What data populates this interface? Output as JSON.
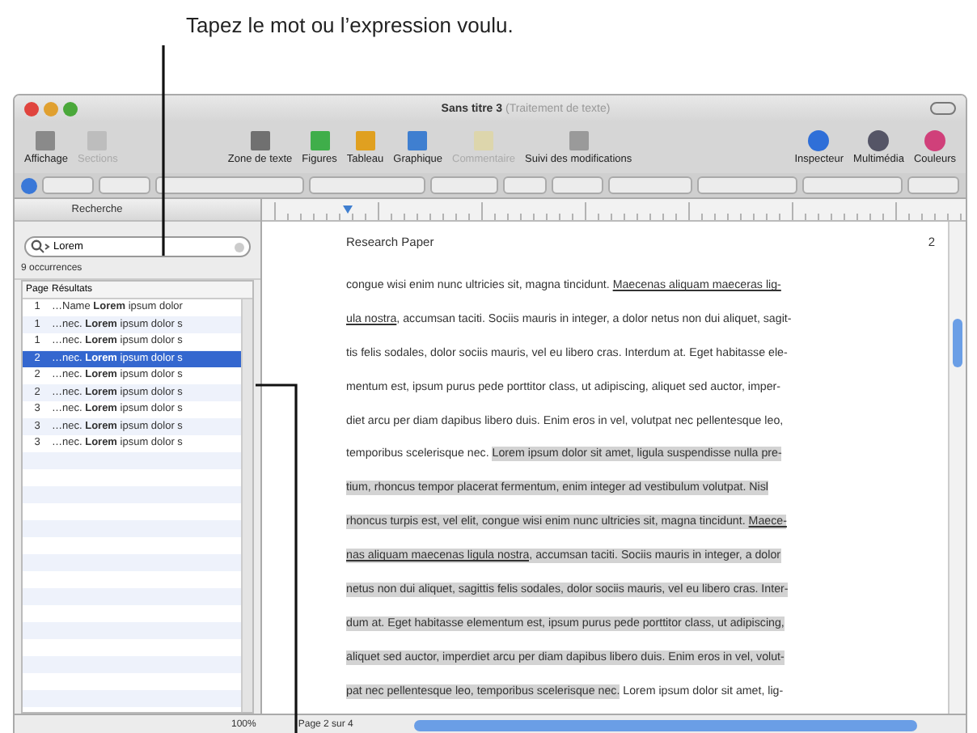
{
  "callout": {
    "text": "Tapez le mot ou l’expression voulu."
  },
  "window": {
    "title": "Sans titre 3",
    "subtitle": "(Traitement de texte)"
  },
  "toolbar": {
    "items": [
      {
        "label": "Affichage",
        "disabled": false
      },
      {
        "label": "Sections",
        "disabled": true
      },
      {
        "label": "Zone de texte",
        "disabled": false
      },
      {
        "label": "Figures",
        "disabled": false
      },
      {
        "label": "Tableau",
        "disabled": false
      },
      {
        "label": "Graphique",
        "disabled": false
      },
      {
        "label": "Commentaire",
        "disabled": true
      },
      {
        "label": "Suivi des modifications",
        "disabled": false
      },
      {
        "label": "Inspecteur",
        "disabled": false
      },
      {
        "label": "Multimédia",
        "disabled": false
      },
      {
        "label": "Couleurs",
        "disabled": false
      }
    ]
  },
  "sidebar": {
    "title": "Recherche",
    "search": {
      "value": "Lorem"
    },
    "count": "9 occurrences",
    "columns": [
      "Page",
      "Résultats"
    ],
    "rows": [
      {
        "page": "1",
        "result": "…Name **Lorem** ipsum dolor",
        "selected": false
      },
      {
        "page": "1",
        "result": "…nec. **Lorem** ipsum dolor s",
        "selected": false
      },
      {
        "page": "1",
        "result": "…nec. **Lorem** ipsum dolor s",
        "selected": false
      },
      {
        "page": "2",
        "result": "…nec. **Lorem** ipsum dolor s",
        "selected": true
      },
      {
        "page": "2",
        "result": "…nec. **Lorem** ipsum dolor s",
        "selected": false
      },
      {
        "page": "2",
        "result": "…nec. **Lorem** ipsum dolor s",
        "selected": false
      },
      {
        "page": "3",
        "result": "…nec. **Lorem** ipsum dolor s",
        "selected": false
      },
      {
        "page": "3",
        "result": "…nec. **Lorem** ipsum dolor s",
        "selected": false
      },
      {
        "page": "3",
        "result": "…nec. **Lorem** ipsum dolor s",
        "selected": false
      }
    ]
  },
  "document": {
    "header": "Research Paper",
    "page_number": "2",
    "lines": [
      [
        {
          "kind": "plain",
          "text": "congue wisi enim nunc ultricies sit, magna tincidunt. "
        },
        {
          "kind": "link",
          "text": "Maecenas aliquam maeceras lig-"
        }
      ],
      [
        {
          "kind": "link",
          "text": "ula nostra"
        },
        {
          "kind": "plain",
          "text": ", accumsan taciti. Sociis mauris in integer, a dolor netus non dui aliquet, sagit-"
        }
      ],
      [
        {
          "kind": "plain",
          "text": "tis felis sodales, dolor sociis mauris, vel eu libero cras. Interdum at. Eget habitasse ele-"
        }
      ],
      [
        {
          "kind": "plain",
          "text": "mentum est, ipsum purus pede porttitor class, ut adipiscing, aliquet sed auctor, imper-"
        }
      ],
      [
        {
          "kind": "plain",
          "text": "diet arcu per diam dapibus libero duis. Enim eros in vel, volutpat nec pellentesque leo,"
        }
      ],
      [
        {
          "kind": "plain",
          "text": "temporibus scelerisque nec. "
        },
        {
          "kind": "selected",
          "text": "Lorem ipsum dolor sit amet, ligula suspendisse nulla pre-"
        }
      ],
      [
        {
          "kind": "selected",
          "text": "tium, rhoncus tempor placerat fermentum, enim integer ad vestibulum volutpat. Nisl"
        }
      ],
      [
        {
          "kind": "selected",
          "text": "rhoncus turpis est, vel elit, congue wisi enim nunc ultricies sit, magna tincidunt. "
        },
        {
          "kind": "selected-link",
          "text": "Maece-"
        }
      ],
      [
        {
          "kind": "selected-link",
          "text": "nas aliquam maecenas ligula nostra"
        },
        {
          "kind": "selected",
          "text": ", accumsan taciti. Sociis mauris in integer, a dolor"
        }
      ],
      [
        {
          "kind": "selected",
          "text": "netus non dui aliquet, sagittis felis sodales, dolor sociis mauris, vel eu libero cras. Inter-"
        }
      ],
      [
        {
          "kind": "selected",
          "text": "dum at. Eget habitasse elementum est, ipsum purus pede porttitor class, ut adipiscing,"
        }
      ],
      [
        {
          "kind": "selected",
          "text": "aliquet sed auctor, imperdiet arcu per diam dapibus libero duis. Enim eros in vel, volut-"
        }
      ],
      [
        {
          "kind": "selected",
          "text": "pat nec pellentesque leo, temporibus scelerisque nec."
        },
        {
          "kind": "plain",
          "text": " Lorem ipsum dolor sit amet, lig-"
        }
      ]
    ]
  },
  "status_bar": {
    "zoom": "100%",
    "page": "Page 2 sur 4"
  }
}
